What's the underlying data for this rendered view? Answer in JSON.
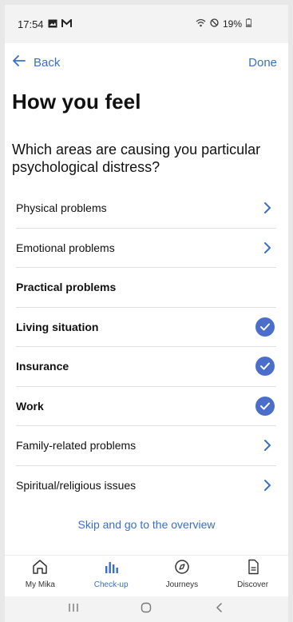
{
  "status_bar": {
    "time": "17:54",
    "battery": "19%"
  },
  "nav": {
    "back_label": "Back",
    "done_label": "Done"
  },
  "page": {
    "title": "How you feel",
    "question": "Which areas are causing you particular psychological distress?"
  },
  "list": [
    {
      "label": "Physical problems",
      "style": "normal",
      "trailing": "chevron"
    },
    {
      "label": "Emotional problems",
      "style": "normal",
      "trailing": "chevron"
    },
    {
      "label": "Practical problems",
      "style": "header",
      "trailing": "none"
    },
    {
      "label": "Living situation",
      "style": "bold",
      "trailing": "check"
    },
    {
      "label": "Insurance",
      "style": "bold",
      "trailing": "check"
    },
    {
      "label": "Work",
      "style": "bold",
      "trailing": "check"
    },
    {
      "label": "Family-related problems",
      "style": "normal",
      "trailing": "chevron"
    },
    {
      "label": "Spiritual/religious issues",
      "style": "normal",
      "trailing": "chevron"
    }
  ],
  "skip_label": "Skip and go to the overview",
  "tabs": [
    {
      "label": "My Mika",
      "icon": "home-icon"
    },
    {
      "label": "Check-up",
      "icon": "bar-chart-icon",
      "active": true
    },
    {
      "label": "Journeys",
      "icon": "compass-icon"
    },
    {
      "label": "Discover",
      "icon": "document-icon"
    }
  ],
  "colors": {
    "accent": "#3a6fc8",
    "check_fill": "#4a6ec9"
  }
}
